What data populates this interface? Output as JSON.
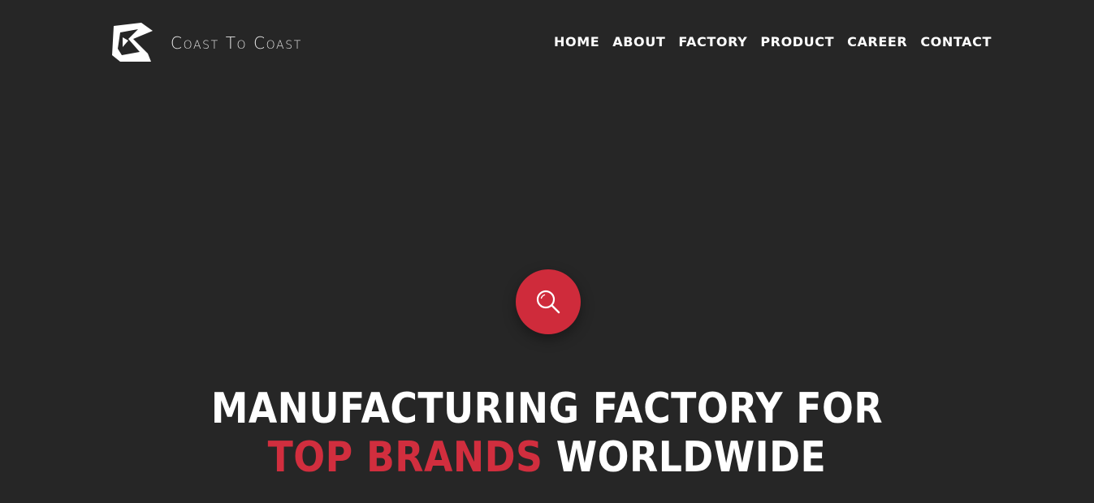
{
  "brand": {
    "name": "Coast To Coast",
    "logo_icon": "coast-to-coast-logo-icon"
  },
  "nav": {
    "items": [
      {
        "label": "HOME"
      },
      {
        "label": "ABOUT"
      },
      {
        "label": "FACTORY"
      },
      {
        "label": "PRODUCT"
      },
      {
        "label": "CAREER"
      },
      {
        "label": "CONTACT"
      }
    ]
  },
  "search": {
    "icon": "search-icon"
  },
  "hero": {
    "line1": "MANUFACTURING FACTORY FOR",
    "line2_accent": "TOP BRANDS",
    "line2_rest": "WORLDWIDE"
  },
  "colors": {
    "background": "#262626",
    "accent": "#cf2b3b",
    "text": "#ffffff"
  }
}
